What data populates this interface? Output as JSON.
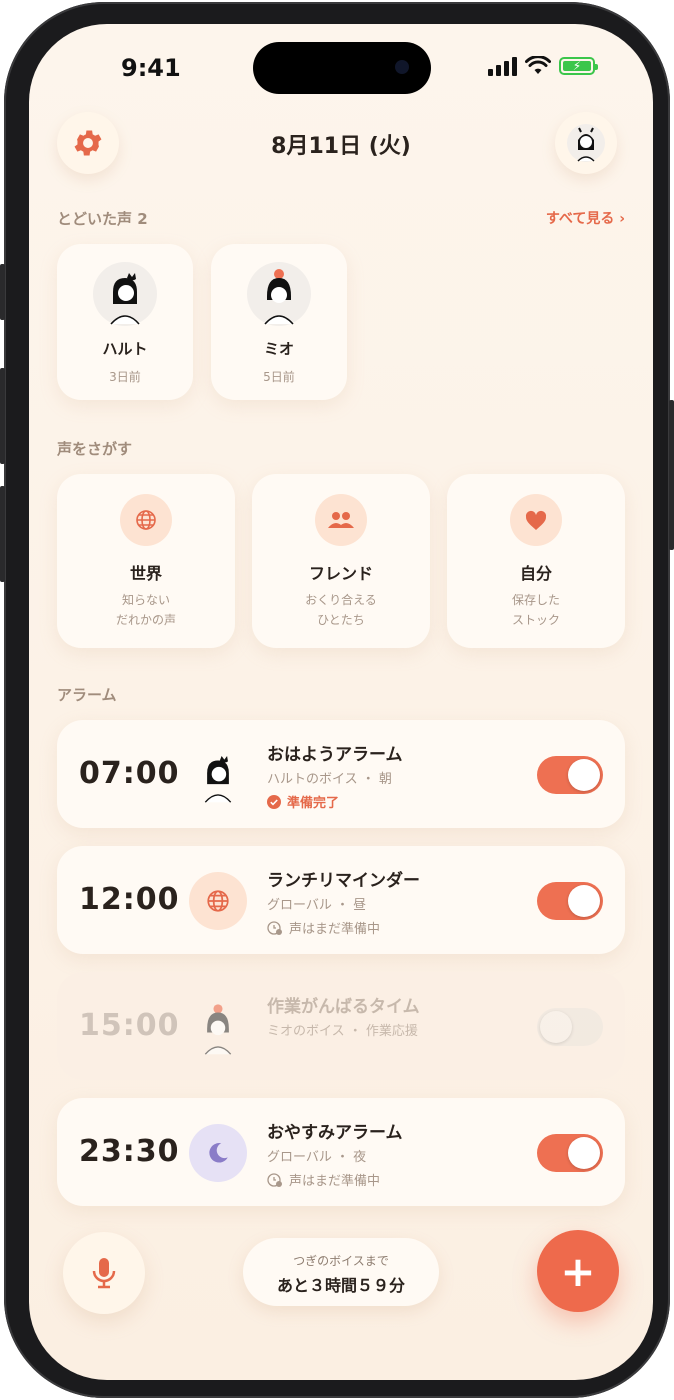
{
  "status": {
    "time": "9:41"
  },
  "header": {
    "date": "8月11日 (火)"
  },
  "received": {
    "title": "とどいた声 2",
    "see_all": "すべて見る ›",
    "voices": [
      {
        "name": "ハルト",
        "ago": "3日前"
      },
      {
        "name": "ミオ",
        "ago": "5日前"
      }
    ]
  },
  "explore": {
    "title": "声をさがす",
    "cards": [
      {
        "icon": "globe-icon",
        "title": "世界",
        "desc1": "知らない",
        "desc2": "だれかの声"
      },
      {
        "icon": "friends-icon",
        "title": "フレンド",
        "desc1": "おくり合える",
        "desc2": "ひとたち"
      },
      {
        "icon": "heart-icon",
        "title": "自分",
        "desc1": "保存した",
        "desc2": "ストック"
      }
    ]
  },
  "alarms": {
    "title": "アラーム",
    "items": [
      {
        "time": "07:00",
        "label": "おはようアラーム",
        "sub": "ハルトのボイス ・ 朝",
        "state": "準備完了",
        "enabled": true
      },
      {
        "time": "12:00",
        "label": "ランチリマインダー",
        "sub": "グローバル ・ 昼",
        "state": "声はまだ準備中",
        "enabled": true
      },
      {
        "time": "15:00",
        "label": "作業がんばるタイム",
        "sub": "ミオのボイス ・ 作業応援",
        "state": "",
        "enabled": false
      },
      {
        "time": "23:30",
        "label": "おやすみアラーム",
        "sub": "グローバル ・ 夜",
        "state": "声はまだ準備中",
        "enabled": true
      }
    ]
  },
  "footer": {
    "next_caption": "つぎのボイスまで",
    "next_value": "あと３時間５９分",
    "add": "+"
  },
  "colors": {
    "accent": "#ee7052",
    "background": "#fdf5ec",
    "card": "#fffaf4"
  }
}
